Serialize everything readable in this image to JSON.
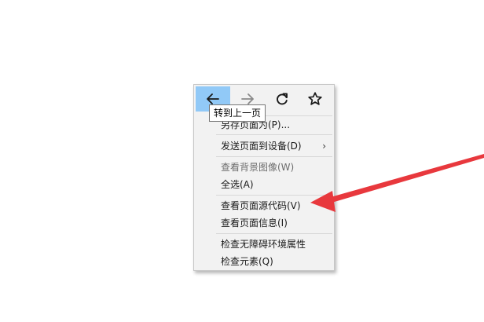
{
  "context_menu": {
    "nav": [
      {
        "name": "back-icon",
        "highlighted": true
      },
      {
        "name": "forward-icon",
        "highlighted": false
      },
      {
        "name": "reload-icon",
        "highlighted": false
      },
      {
        "name": "bookmark-star-icon",
        "highlighted": false
      }
    ],
    "items": [
      {
        "label": "另存页面为(P)...",
        "disabled": false
      },
      {
        "label": "发送页面到设备(D)",
        "disabled": false,
        "submenu": true,
        "submenu_glyph": "›"
      },
      {
        "label": "查看背景图像(W)",
        "disabled": true
      },
      {
        "label": "全选(A)",
        "disabled": false
      },
      {
        "label": "查看页面源代码(V)",
        "disabled": false
      },
      {
        "label": "查看页面信息(I)",
        "disabled": false
      },
      {
        "label": "检查无障碍环境属性",
        "disabled": false
      },
      {
        "label": "检查元素(Q)",
        "disabled": false
      }
    ]
  },
  "tooltip": {
    "text": "转到上一页"
  },
  "annotation": {
    "color": "#e8383d"
  },
  "colors": {
    "highlight": "#91c9f7",
    "menu_bg": "#f2f2f2"
  }
}
